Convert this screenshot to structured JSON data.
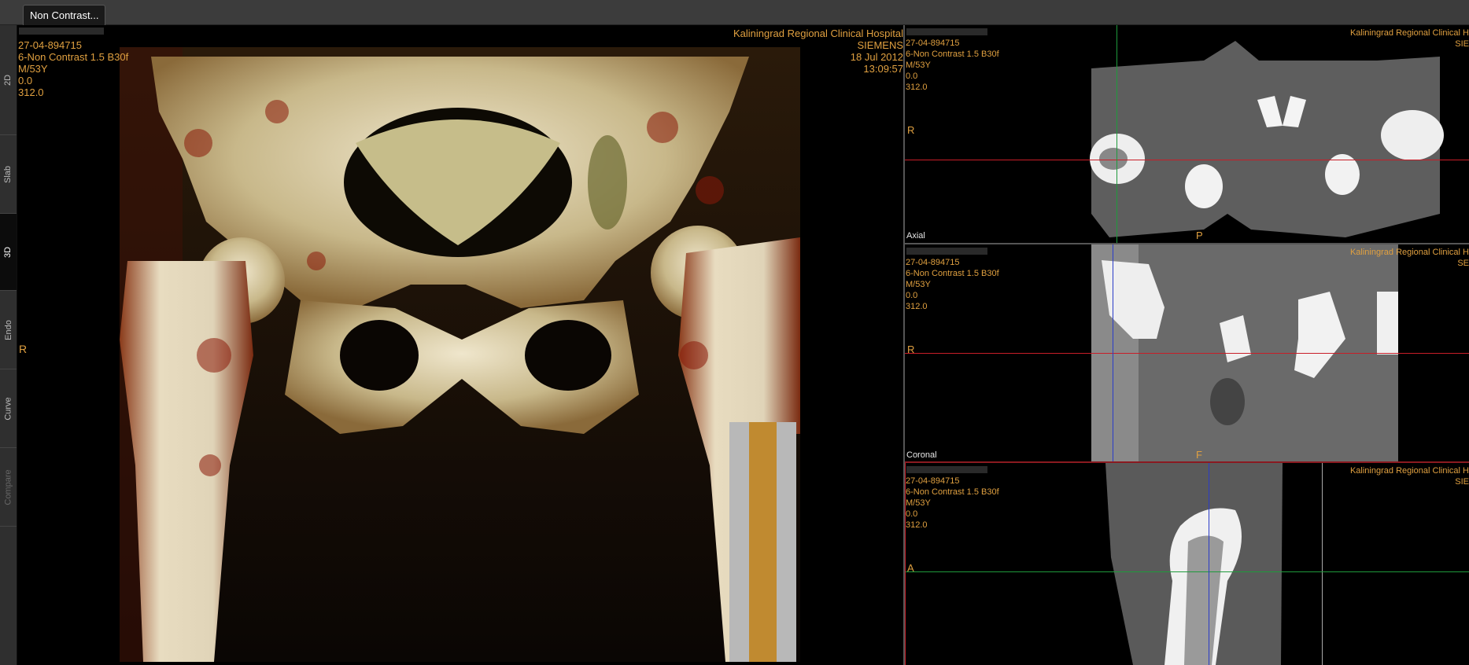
{
  "window": {
    "tab_label": "Non  Contrast..."
  },
  "sidebar": {
    "tabs": [
      {
        "label": "2D",
        "state": "normal"
      },
      {
        "label": "Slab",
        "state": "normal"
      },
      {
        "label": "3D",
        "state": "active"
      },
      {
        "label": "Endo",
        "state": "normal"
      },
      {
        "label": "Curve",
        "state": "normal"
      },
      {
        "label": "Compare",
        "state": "disabled"
      }
    ]
  },
  "main_view": {
    "patient_id": "27-04-894715",
    "series": "6-Non Contrast  1.5  B30f",
    "patient": "M/53Y",
    "value1": "0.0",
    "value2": "312.0",
    "hospital": "Kaliningrad Regional Clinical Hospital",
    "vendor": "SIEMENS",
    "date": "18 Jul 2012",
    "time": "13:09:57",
    "orientation": "R"
  },
  "axial_view": {
    "patient_id": "27-04-894715",
    "series": "6-Non Contrast  1.5  B30f",
    "patient": "M/53Y",
    "value1": "0.0",
    "value2": "312.0",
    "hospital": "Kaliningrad Regional Clinical H",
    "vendor": "SIE",
    "name": "Axial",
    "left_marker": "R",
    "bottom_marker": "P"
  },
  "coronal_view": {
    "patient_id": "27-04-894715",
    "series": "6-Non Contrast  1.5  B30f",
    "patient": "M/53Y",
    "value1": "0.0",
    "value2": "312.0",
    "hospital": "Kaliningrad Regional Clinical H",
    "vendor": "SE",
    "name": "Coronal",
    "left_marker": "R",
    "bottom_marker": "F"
  },
  "sagittal_view": {
    "patient_id": "27-04-894715",
    "series": "6-Non Contrast  1.5  B30f",
    "patient": "M/53Y",
    "value1": "0.0",
    "value2": "312.0",
    "hospital": "Kaliningrad Regional Clinical H",
    "vendor": "SIE",
    "left_marker": "A"
  },
  "colors": {
    "overlay_text": "#e0a040",
    "crosshair_red": "#c81e28",
    "crosshair_green": "#1e9a3c",
    "crosshair_blue": "#2a3cc8"
  }
}
